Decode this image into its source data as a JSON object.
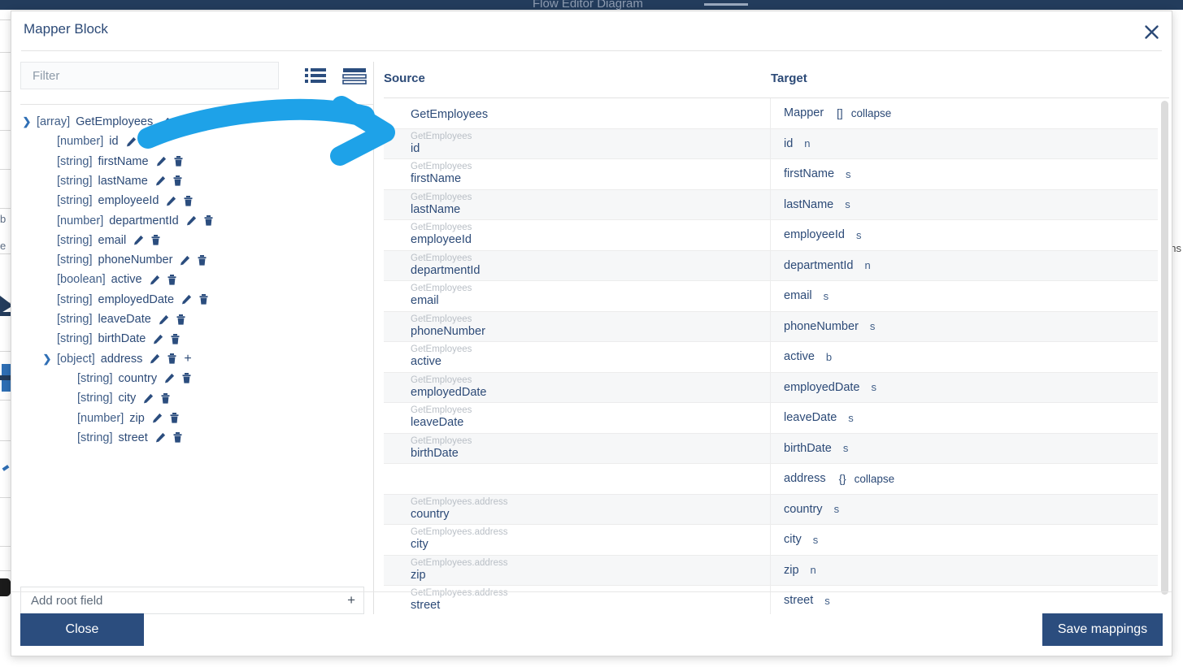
{
  "app": {
    "background_title": "Flow Editor Diagram"
  },
  "modal": {
    "title": "Mapper Block",
    "close_icon": "close-icon"
  },
  "left_panel": {
    "filter": {
      "placeholder": "Filter",
      "value": ""
    },
    "view_toggles": [
      {
        "name": "list-view-icon",
        "label": "list"
      },
      {
        "name": "lines-view-icon",
        "label": "lines"
      }
    ],
    "tree": [
      {
        "type": "[array]",
        "name": "GetEmployees",
        "depth": 0,
        "caret": "expanded",
        "icons": [
          "pencil"
        ]
      },
      {
        "type": "[number]",
        "name": "id",
        "depth": 1,
        "caret": "none",
        "icons": [
          "pencil",
          "trash"
        ]
      },
      {
        "type": "[string]",
        "name": "firstName",
        "depth": 1,
        "caret": "none",
        "icons": [
          "pencil",
          "trash"
        ]
      },
      {
        "type": "[string]",
        "name": "lastName",
        "depth": 1,
        "caret": "none",
        "icons": [
          "pencil",
          "trash"
        ]
      },
      {
        "type": "[string]",
        "name": "employeeId",
        "depth": 1,
        "caret": "none",
        "icons": [
          "pencil",
          "trash"
        ]
      },
      {
        "type": "[number]",
        "name": "departmentId",
        "depth": 1,
        "caret": "none",
        "icons": [
          "pencil",
          "trash"
        ]
      },
      {
        "type": "[string]",
        "name": "email",
        "depth": 1,
        "caret": "none",
        "icons": [
          "pencil",
          "trash"
        ]
      },
      {
        "type": "[string]",
        "name": "phoneNumber",
        "depth": 1,
        "caret": "none",
        "icons": [
          "pencil",
          "trash"
        ]
      },
      {
        "type": "[boolean]",
        "name": "active",
        "depth": 1,
        "caret": "none",
        "icons": [
          "pencil",
          "trash"
        ]
      },
      {
        "type": "[string]",
        "name": "employedDate",
        "depth": 1,
        "caret": "none",
        "icons": [
          "pencil",
          "trash"
        ]
      },
      {
        "type": "[string]",
        "name": "leaveDate",
        "depth": 1,
        "caret": "none",
        "icons": [
          "pencil",
          "trash"
        ]
      },
      {
        "type": "[string]",
        "name": "birthDate",
        "depth": 1,
        "caret": "none",
        "icons": [
          "pencil",
          "trash"
        ]
      },
      {
        "type": "[object]",
        "name": "address",
        "depth": 1,
        "caret": "expanded",
        "icons": [
          "pencil",
          "trash",
          "plus"
        ]
      },
      {
        "type": "[string]",
        "name": "country",
        "depth": 2,
        "caret": "none",
        "icons": [
          "pencil",
          "trash"
        ]
      },
      {
        "type": "[string]",
        "name": "city",
        "depth": 2,
        "caret": "none",
        "icons": [
          "pencil",
          "trash"
        ]
      },
      {
        "type": "[number]",
        "name": "zip",
        "depth": 2,
        "caret": "none",
        "icons": [
          "pencil",
          "trash"
        ]
      },
      {
        "type": "[string]",
        "name": "street",
        "depth": 2,
        "caret": "none",
        "icons": [
          "pencil",
          "trash"
        ]
      }
    ],
    "add_root_field": {
      "placeholder": "Add root field",
      "value": "",
      "plus_label": "+"
    }
  },
  "mapping_table": {
    "headers": {
      "source": "Source",
      "target": "Target"
    },
    "rows": [
      {
        "source_path": "",
        "source_name": "GetEmployees",
        "source_single": true,
        "target_name": "Mapper",
        "target_type": "",
        "target_badge": "[]",
        "target_collapse": "collapse",
        "shaded": false
      },
      {
        "source_path": "GetEmployees",
        "source_name": "id",
        "source_single": false,
        "target_name": "id",
        "target_type": "n",
        "target_badge": "",
        "target_collapse": "",
        "shaded": true
      },
      {
        "source_path": "GetEmployees",
        "source_name": "firstName",
        "source_single": false,
        "target_name": "firstName",
        "target_type": "s",
        "target_badge": "",
        "target_collapse": "",
        "shaded": false
      },
      {
        "source_path": "GetEmployees",
        "source_name": "lastName",
        "source_single": false,
        "target_name": "lastName",
        "target_type": "s",
        "target_badge": "",
        "target_collapse": "",
        "shaded": true
      },
      {
        "source_path": "GetEmployees",
        "source_name": "employeeId",
        "source_single": false,
        "target_name": "employeeId",
        "target_type": "s",
        "target_badge": "",
        "target_collapse": "",
        "shaded": false
      },
      {
        "source_path": "GetEmployees",
        "source_name": "departmentId",
        "source_single": false,
        "target_name": "departmentId",
        "target_type": "n",
        "target_badge": "",
        "target_collapse": "",
        "shaded": true
      },
      {
        "source_path": "GetEmployees",
        "source_name": "email",
        "source_single": false,
        "target_name": "email",
        "target_type": "s",
        "target_badge": "",
        "target_collapse": "",
        "shaded": false
      },
      {
        "source_path": "GetEmployees",
        "source_name": "phoneNumber",
        "source_single": false,
        "target_name": "phoneNumber",
        "target_type": "s",
        "target_badge": "",
        "target_collapse": "",
        "shaded": true
      },
      {
        "source_path": "GetEmployees",
        "source_name": "active",
        "source_single": false,
        "target_name": "active",
        "target_type": "b",
        "target_badge": "",
        "target_collapse": "",
        "shaded": false
      },
      {
        "source_path": "GetEmployees",
        "source_name": "employedDate",
        "source_single": false,
        "target_name": "employedDate",
        "target_type": "s",
        "target_badge": "",
        "target_collapse": "",
        "shaded": true
      },
      {
        "source_path": "GetEmployees",
        "source_name": "leaveDate",
        "source_single": false,
        "target_name": "leaveDate",
        "target_type": "s",
        "target_badge": "",
        "target_collapse": "",
        "shaded": false
      },
      {
        "source_path": "GetEmployees",
        "source_name": "birthDate",
        "source_single": false,
        "target_name": "birthDate",
        "target_type": "s",
        "target_badge": "",
        "target_collapse": "",
        "shaded": true
      },
      {
        "source_path": "",
        "source_name": "",
        "source_single": true,
        "target_name": "address",
        "target_type": "",
        "target_badge": "{}",
        "target_collapse": "collapse",
        "shaded": false
      },
      {
        "source_path": "GetEmployees.address",
        "source_name": "country",
        "source_single": false,
        "target_name": "country",
        "target_type": "s",
        "target_badge": "",
        "target_collapse": "",
        "shaded": true
      },
      {
        "source_path": "GetEmployees.address",
        "source_name": "city",
        "source_single": false,
        "target_name": "city",
        "target_type": "s",
        "target_badge": "",
        "target_collapse": "",
        "shaded": false
      },
      {
        "source_path": "GetEmployees.address",
        "source_name": "zip",
        "source_single": false,
        "target_name": "zip",
        "target_type": "n",
        "target_badge": "",
        "target_collapse": "",
        "shaded": true
      },
      {
        "source_path": "GetEmployees.address",
        "source_name": "street",
        "source_single": false,
        "target_name": "street",
        "target_type": "s",
        "target_badge": "",
        "target_collapse": "",
        "shaded": false
      }
    ]
  },
  "footer": {
    "close_label": "Close",
    "save_label": "Save mappings"
  },
  "annotation": {
    "arrow_color": "#1ea2e8",
    "description": "curved arrow from source tree id field to mapping table id row"
  },
  "colors": {
    "primary": "#2b4d7e",
    "text": "#2c4a77",
    "muted": "#b9bfc6",
    "accent": "#1ea2e8",
    "row_shade": "#f6f7f8"
  }
}
